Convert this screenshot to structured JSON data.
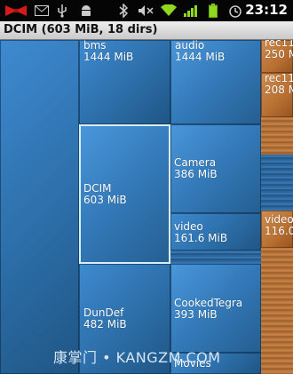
{
  "status_bar": {
    "time": "23:12",
    "icons": [
      "bow-icon",
      "mail-icon",
      "usb-icon",
      "android-icon",
      "bluetooth-icon",
      "mute-icon",
      "wifi-icon",
      "signal-icon",
      "battery-icon",
      "alarm-icon"
    ]
  },
  "header": {
    "title": "DCIM (603 MiB, 18 dirs)"
  },
  "tiles": {
    "bms": {
      "name": "bms",
      "size": "1444 MiB"
    },
    "audio": {
      "name": "audio",
      "size": "1444 MiB"
    },
    "rec1": {
      "name": "rec11",
      "size": "250 M"
    },
    "rec2": {
      "name": "rec11",
      "size": "208 M"
    },
    "dcim": {
      "name": "DCIM",
      "size": "603 MiB"
    },
    "camera": {
      "name": "Camera",
      "size": "386 MiB"
    },
    "video": {
      "name": "video",
      "size": "161.6 MiB"
    },
    "video2": {
      "name": "video",
      "size": "116.0"
    },
    "dundef": {
      "name": "DunDef",
      "size": "482 MiB"
    },
    "cookedtegra": {
      "name": "CookedTegra",
      "size": "393 MiB"
    },
    "movies": {
      "name": "Movies",
      "size": ""
    }
  },
  "watermark": "康掌门 • KANGZM.COM",
  "colors": {
    "folder_blue": "#2f76b8",
    "folder_orange": "#b8733a",
    "selection_border": "#d9eefb",
    "title_bg": "#dcdcdc"
  }
}
